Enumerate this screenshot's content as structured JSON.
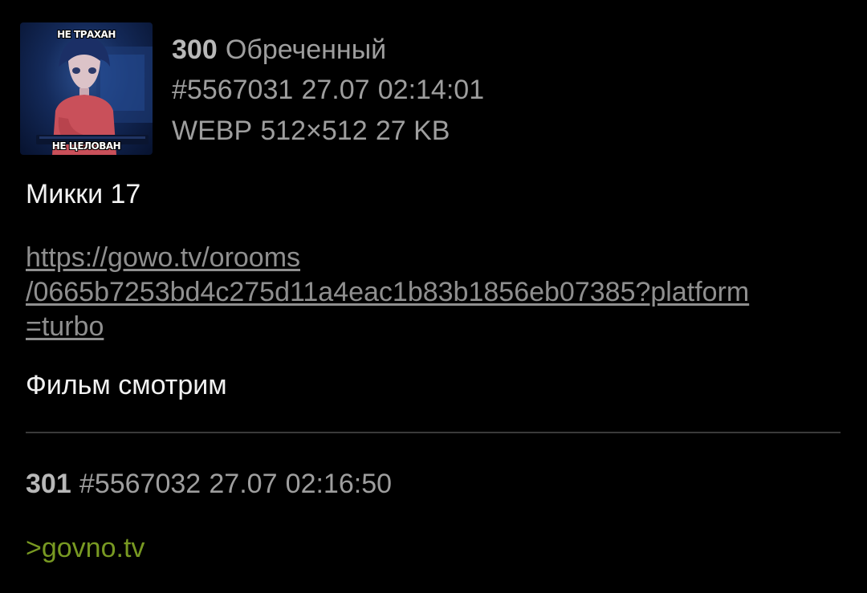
{
  "posts": [
    {
      "number": "300",
      "author": "Обреченный",
      "id": "#5567031",
      "date": "27.07",
      "time": "02:14:01",
      "file": {
        "format": "WEBP",
        "dimensions": "512×512",
        "size": "27 KB",
        "caption_top": "НЕ ТРАХАН",
        "caption_bottom": "НЕ ЦЕЛОВАН"
      },
      "text_line1": "Микки 17",
      "link_lines": [
        "https://gowo.tv/orooms",
        "/0665b7253bd4c275d11a4eac1b83b1856eb07385?platform",
        "=turbo"
      ],
      "text_line2": "Фильм смотрим"
    },
    {
      "number": "301",
      "id": "#5567032",
      "date": "27.07",
      "time": "02:16:50",
      "quote": ">govno.tv"
    }
  ],
  "colors": {
    "background": "#000000",
    "meta": "#9e9e9e",
    "text": "#f2f2f2",
    "link": "#8f8f8f",
    "greentext": "#789922",
    "divider": "#3a3a3a"
  }
}
